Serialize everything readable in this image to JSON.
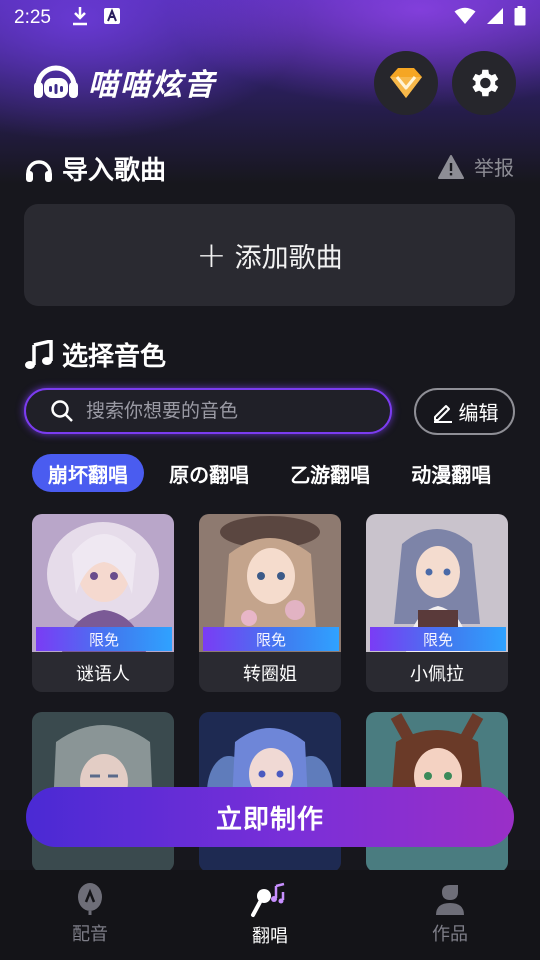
{
  "status_bar": {
    "time": "2:25"
  },
  "header": {
    "app_title": "喵喵炫音"
  },
  "import_section": {
    "title": "导入歌曲",
    "report_label": "举报",
    "add_song_label": "添加歌曲",
    "add_song_plus": "+"
  },
  "voice_section": {
    "title": "选择音色",
    "search_placeholder": "搜索你想要的音色",
    "edit_label": "编辑",
    "tabs": [
      "崩坏翻唱",
      "原の翻唱",
      "乙游翻唱",
      "动漫翻唱"
    ],
    "cards": [
      {
        "name": "谜语人",
        "badge": "限免"
      },
      {
        "name": "转圈姐",
        "badge": "限免"
      },
      {
        "name": "小佩拉",
        "badge": "限免"
      }
    ]
  },
  "make_button_label": "立即制作",
  "bottom_nav": {
    "items": [
      "配音",
      "翻唱",
      "作品"
    ]
  },
  "colors": {
    "accent": "#4a5cf0",
    "search_border": "#7b3cf0",
    "vip_gold": "#f5a623"
  }
}
